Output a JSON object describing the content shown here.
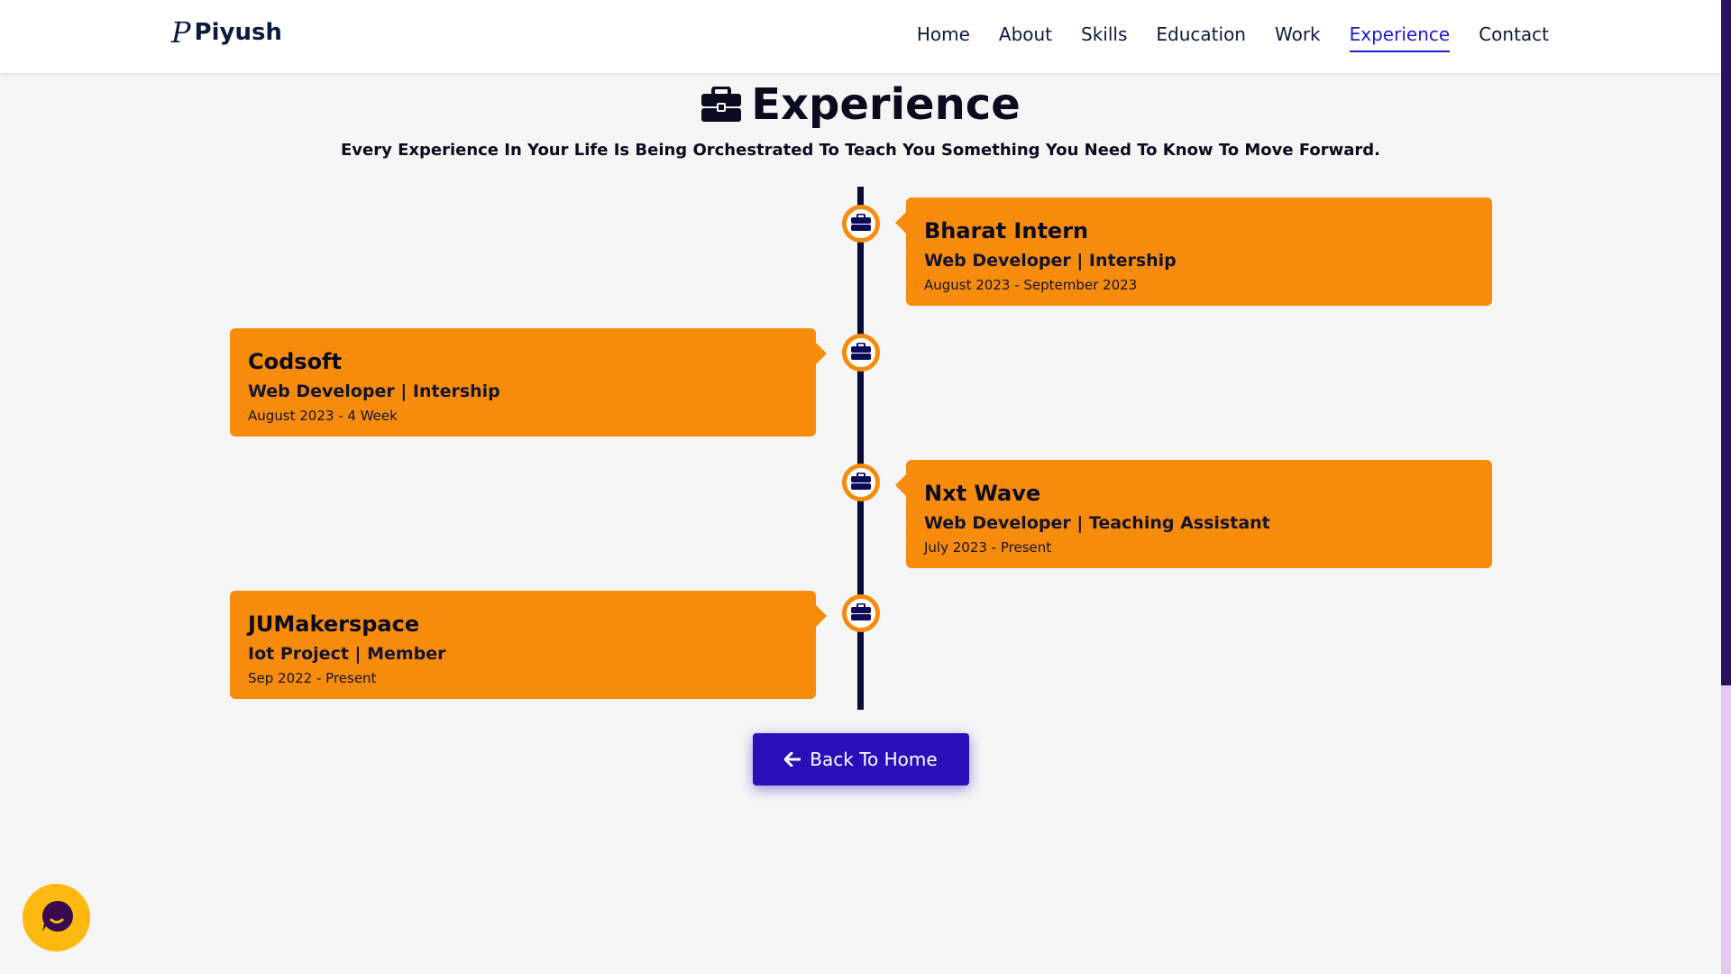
{
  "navbar": {
    "brand": "Piyush",
    "items": [
      {
        "label": "Home",
        "active": false
      },
      {
        "label": "About",
        "active": false
      },
      {
        "label": "Skills",
        "active": false
      },
      {
        "label": "Education",
        "active": false
      },
      {
        "label": "Work",
        "active": false
      },
      {
        "label": "Experience",
        "active": true
      },
      {
        "label": "Contact",
        "active": false
      }
    ]
  },
  "heading": {
    "title": "Experience",
    "subtitle": "Every Experience In Your Life Is Being Orchestrated To Teach You Something You Need To Know To Move Forward."
  },
  "experiences": [
    {
      "company": "Bharat Intern",
      "role": "Web Developer | Intership",
      "dates": "August 2023 - September 2023",
      "side": "right"
    },
    {
      "company": "Codsoft",
      "role": "Web Developer | Intership",
      "dates": "August 2023 - 4 Week",
      "side": "left"
    },
    {
      "company": "Nxt Wave",
      "role": "Web Developer | Teaching Assistant",
      "dates": "July 2023 - Present",
      "side": "right"
    },
    {
      "company": "JUMakerspace",
      "role": "Iot Project | Member",
      "dates": "Sep 2022 - Present",
      "side": "left"
    }
  ],
  "back_button": {
    "label": "Back To Home",
    "icon": "arrow-left-icon"
  },
  "icons": {
    "heading": "briefcase-icon",
    "marker": "briefcase-icon",
    "chat": "chat-icon",
    "brand": "pinterest-p-icon"
  },
  "colors": {
    "accent": "#f68b0c",
    "nav_active": "#1b1bd1",
    "button": "#2a0fb8",
    "timeline": "#0b0b3a",
    "chat": "#fdb910"
  }
}
